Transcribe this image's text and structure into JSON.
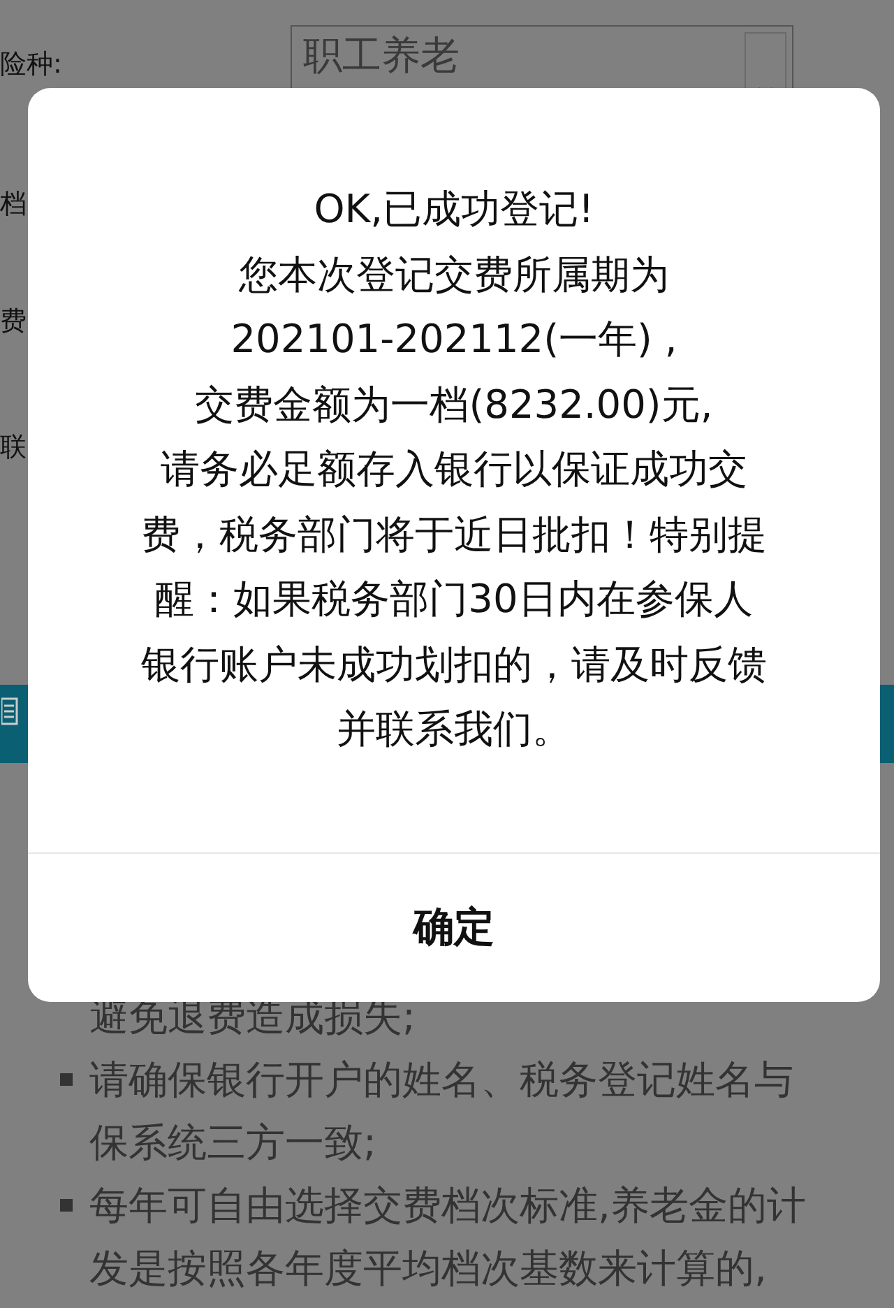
{
  "form": {
    "labels": [
      "险种:",
      "档",
      "费",
      "联"
    ],
    "insurance_select": {
      "value": "职工养老"
    }
  },
  "notes": [
    {
      "bullet": false,
      "lines": [
        "避免退费造成损失;"
      ]
    },
    {
      "bullet": true,
      "lines": [
        "请确保银行开户的姓名、税务登记姓名与",
        "保系统三方一致;"
      ]
    },
    {
      "bullet": true,
      "lines": [
        "每年可自由选择交费档次标准,养老金的计",
        "发是按照各年度平均档次基数来计算的,"
      ]
    }
  ],
  "dialog": {
    "message_lines": [
      "OK,已成功登记!",
      "您本次登记交费所属期为",
      "202101-202112(一年) ,",
      "交费金额为一档(8232.00)元,",
      "请务必足额存入银行以保证成功交",
      "费，税务部门将于近日批扣！特别提",
      "醒：如果税务部门30日内在参保人",
      "银行账户未成功划扣的，请及时反馈",
      "并联系我们。"
    ],
    "button": "确定"
  }
}
